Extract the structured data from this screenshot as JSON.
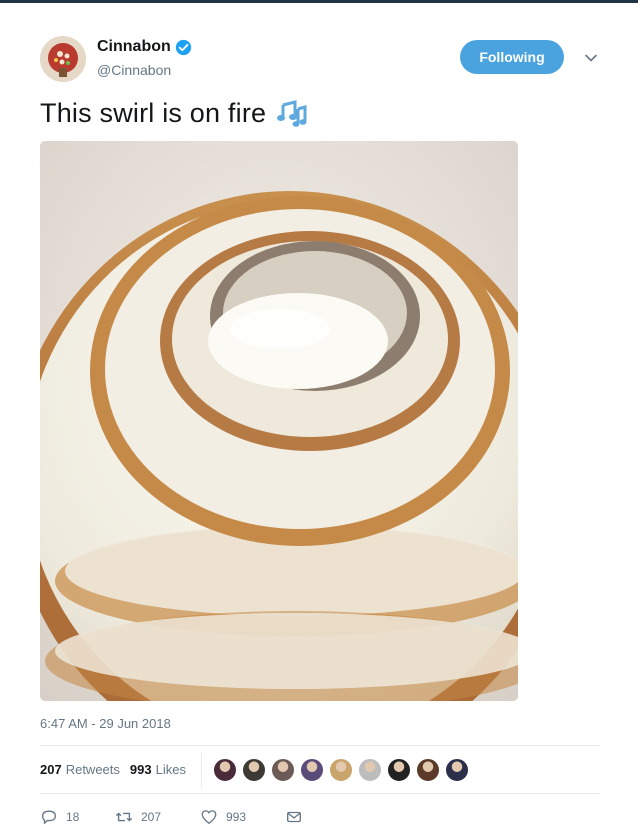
{
  "account": {
    "name": "Cinnabon",
    "handle": "@Cinnabon",
    "verified": true
  },
  "follow_button": {
    "label": "Following"
  },
  "tweet": {
    "text": "This swirl is on fire",
    "emoji_icon": "musical-notes-icon",
    "timestamp": "6:47 AM - 29 Jun 2018"
  },
  "stats": {
    "retweets_count": "207",
    "retweets_label": "Retweets",
    "likes_count": "993",
    "likes_label": "Likes"
  },
  "liker_avatars": [
    "#4a2b3a",
    "#3d3a35",
    "#6b5a55",
    "#5a4b7a",
    "#c9a46b",
    "#bcbcbc",
    "#222222",
    "#5b3a2a",
    "#2b2f4a"
  ],
  "actions": {
    "reply_count": "18",
    "retweet_count": "207",
    "like_count": "993"
  },
  "colors": {
    "accent": "#4aa3df",
    "secondary_text": "#657786",
    "primary_text": "#14171a"
  }
}
